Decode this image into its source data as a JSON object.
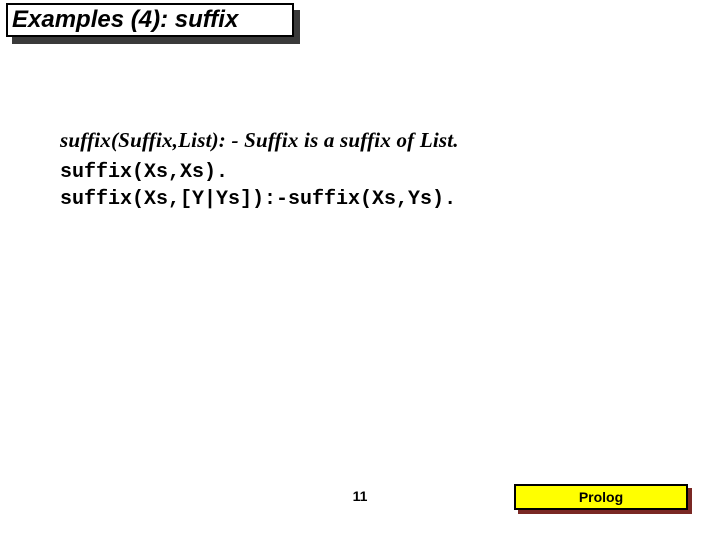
{
  "title": "Examples (4): suffix",
  "description": "suffix(Suffix,List): - Suffix is a suffix of List.",
  "code": {
    "line1": "suffix(Xs,Xs).",
    "line2": "suffix(Xs,[Y|Ys]):-suffix(Xs,Ys)."
  },
  "page_number": "11",
  "badge": "Prolog"
}
